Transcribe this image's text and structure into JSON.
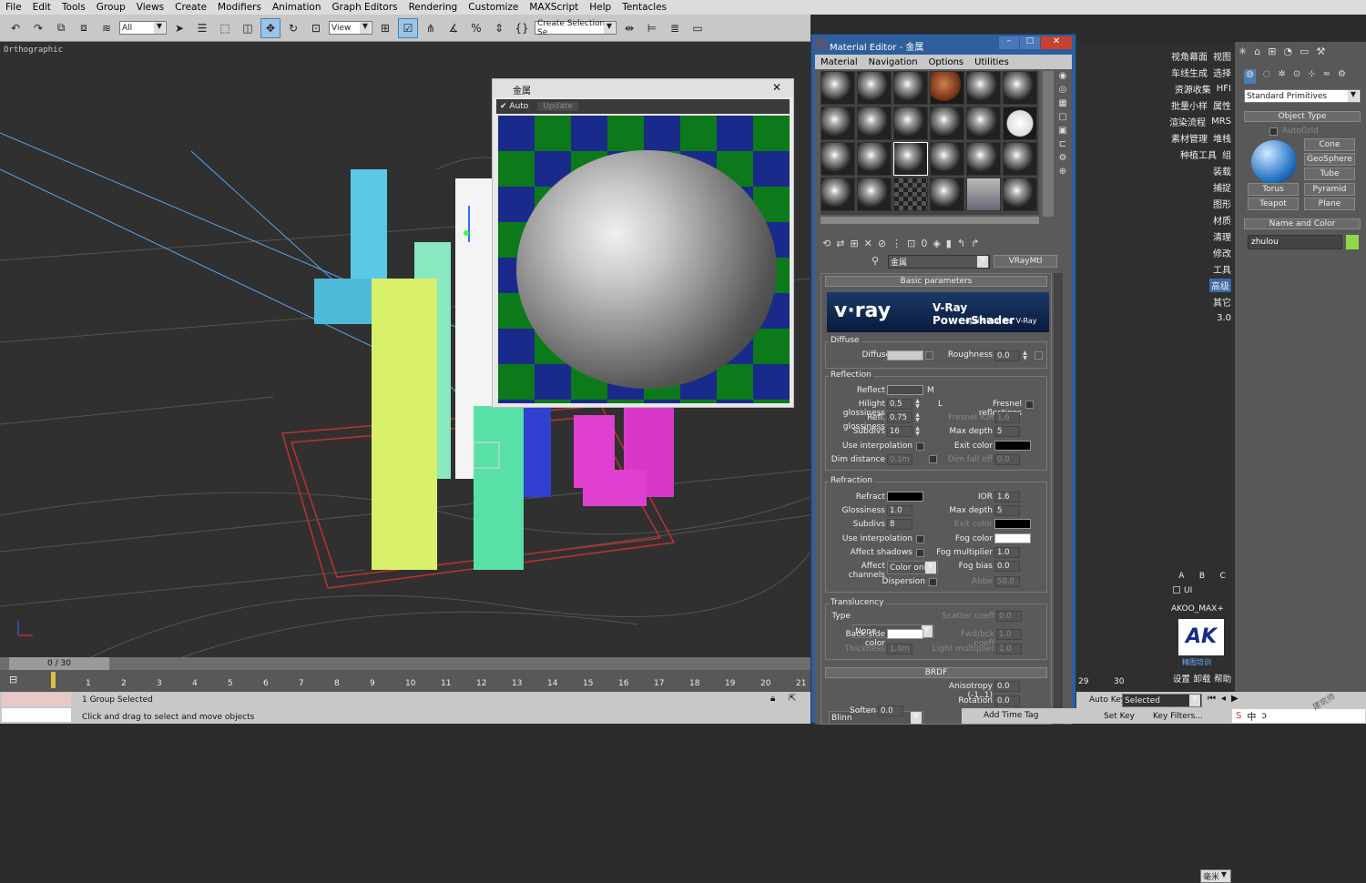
{
  "menu": [
    "File",
    "Edit",
    "Tools",
    "Group",
    "Views",
    "Create",
    "Modifiers",
    "Animation",
    "Graph Editors",
    "Rendering",
    "Customize",
    "MAXScript",
    "Help",
    "Tentacles"
  ],
  "toolbar": {
    "filter_value": "All",
    "view_value": "View",
    "selection_set_placeholder": "Create Selection Se"
  },
  "viewport": {
    "label": "Orthographic"
  },
  "preview": {
    "title": "金属",
    "auto_label": "Auto",
    "update_label": "Update"
  },
  "timeline": {
    "counter": "0 / 30",
    "ticks": [
      "1",
      "2",
      "3",
      "4",
      "5",
      "6",
      "7",
      "8",
      "9",
      "10",
      "11",
      "12",
      "13",
      "14",
      "15",
      "16",
      "17",
      "18",
      "19",
      "20",
      "21"
    ],
    "ticks_right": [
      "29",
      "30"
    ]
  },
  "status": {
    "selection": "1 Group Selected",
    "prompt": "Click and drag to select and move objects",
    "add_time_tag": "Add Time Tag",
    "auto_key": "Auto Key",
    "set_key": "Set Key",
    "key_mode_value": "Selected",
    "key_filters": "Key Filters..."
  },
  "material_editor": {
    "title": "Material Editor - 金属",
    "menu": [
      "Material",
      "Navigation",
      "Options",
      "Utilities"
    ],
    "material_name": "金属",
    "material_type": "VRayMtl",
    "basic_parameters": "Basic parameters",
    "banner_brand": "v·ray",
    "banner_title": "V-Ray PowerShader",
    "banner_subtitle": "optimized for V-Ray",
    "diffuse": {
      "group": "Diffuse",
      "diffuse_label": "Diffuse",
      "roughness_label": "Roughness",
      "roughness_value": "0.0"
    },
    "reflection": {
      "group": "Reflection",
      "reflect_label": "Reflect",
      "m_label": "M",
      "hilight_label": "Hilight glossiness",
      "hilight_value": "0.5",
      "l_label": "L",
      "fresnel_label": "Fresnel reflections",
      "refl_gloss_label": "Refl. glossiness",
      "refl_gloss_value": "0.75",
      "fresnel_ior_label": "Fresnel IOR",
      "fresnel_ior_value": "1.6",
      "subdivs_label": "Subdivs",
      "subdivs_value": "16",
      "max_depth_label": "Max depth",
      "max_depth_value": "5",
      "use_interp_label": "Use interpolation",
      "exit_color_label": "Exit color",
      "dim_distance_label": "Dim distance",
      "dim_distance_value": "0.1m",
      "dim_falloff_label": "Dim fall off",
      "dim_falloff_value": "0.0"
    },
    "refraction": {
      "group": "Refraction",
      "refract_label": "Refract",
      "ior_label": "IOR",
      "ior_value": "1.6",
      "gloss_label": "Glossiness",
      "gloss_value": "1.0",
      "max_depth_label": "Max depth",
      "max_depth_value": "5",
      "subdivs_label": "Subdivs",
      "subdivs_value": "8",
      "exit_color_label": "Exit color",
      "use_interp_label": "Use interpolation",
      "fog_color_label": "Fog color",
      "affect_shadows_label": "Affect shadows",
      "fog_mult_label": "Fog multiplier",
      "fog_mult_value": "1.0",
      "affect_channels_label": "Affect channels",
      "affect_channels_value": "Color only",
      "fog_bias_label": "Fog bias",
      "fog_bias_value": "0.0",
      "dispersion_label": "Dispersion",
      "abbe_label": "Abbe",
      "abbe_value": "50.0"
    },
    "translucency": {
      "group": "Translucency",
      "type_label": "Type",
      "type_value": "None",
      "scatter_label": "Scatter coeff",
      "scatter_value": "0.0",
      "backside_label": "Back-side color",
      "fwd_label": "Fwd/bck coeff",
      "fwd_value": "1.0",
      "thickness_label": "Thickness",
      "thickness_value": "1.0m",
      "light_mult_label": "Light multiplier",
      "light_mult_value": "1.0"
    },
    "brdf": {
      "header": "BRDF",
      "type_value": "Blinn",
      "anisotropy_label": "Anisotropy (-1..1)",
      "anisotropy_value": "0.0",
      "rotation_label": "Rotation",
      "rotation_value": "0.0",
      "soften_label": "Soften",
      "soften_value": "0.0"
    }
  },
  "cmd_tabs_cn": [
    [
      "视角幕面",
      "视图"
    ],
    [
      "车线生成",
      "选择"
    ],
    [
      "资源收集",
      "HFI"
    ],
    [
      "批量小样",
      "属性"
    ],
    [
      "渲染流程",
      "MRS"
    ],
    [
      "素材管理",
      "堆栈"
    ],
    [
      "种植工具",
      "组"
    ]
  ],
  "cmd_tabs_single": [
    "装载",
    "捕捉",
    "图形",
    "材质",
    "清理",
    "修改",
    "工具",
    "高级",
    "其它",
    "3.0"
  ],
  "cmd_bottom": {
    "abc": [
      "A",
      "B",
      "C"
    ],
    "ui_label": "UI",
    "unit_value": "毫米",
    "plugin_name": "AKOO_MAX+",
    "logo_text": "AK",
    "logo_sub": "精图培训",
    "footer": [
      "设置",
      "卸载",
      "帮助"
    ]
  },
  "command_panel": {
    "category_value": "Standard Primitives",
    "object_type_header": "Object Type",
    "autogrid_label": "AutoGrid",
    "buttons": [
      "Cone",
      "GeoSphere",
      "Torus",
      "Tube",
      "Teapot",
      "Pyramid",
      "Plane"
    ],
    "name_color_header": "Name and Color",
    "object_name": "zhulou",
    "object_color": "#8ed84a"
  },
  "watermark": "建筑师"
}
